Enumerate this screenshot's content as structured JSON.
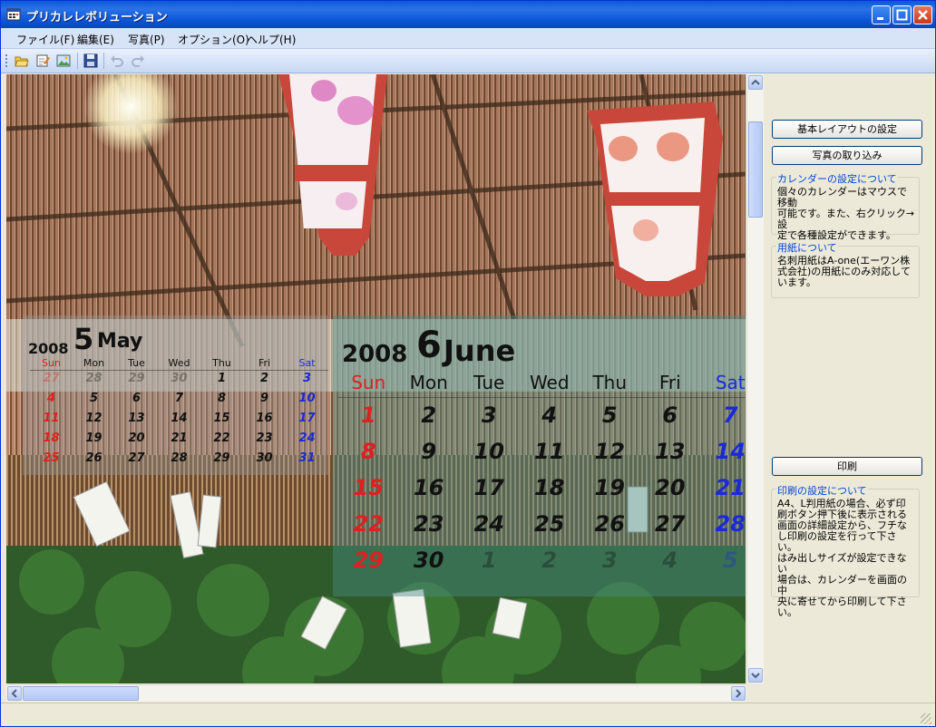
{
  "window": {
    "title": "プリカレレボリューション",
    "controls": [
      "minimize",
      "maximize",
      "close"
    ]
  },
  "menu": [
    "ファイル(F)",
    "編集(E)",
    "写真(P)",
    "オプション(O)",
    "ヘルプ(H)"
  ],
  "toolbar": [
    "open-icon",
    "edit-icon",
    "image-icon",
    "save-icon",
    "undo-icon",
    "redo-icon"
  ],
  "calendar_may": {
    "year": "2008",
    "month_num": "5",
    "month_name": "May",
    "weekdays": [
      "Sun",
      "Mon",
      "Tue",
      "Wed",
      "Thu",
      "Fri",
      "Sat"
    ],
    "weeks": [
      [
        "27",
        "28",
        "29",
        "30",
        "1",
        "2",
        "3"
      ],
      [
        "4",
        "5",
        "6",
        "7",
        "8",
        "9",
        "10"
      ],
      [
        "11",
        "12",
        "13",
        "14",
        "15",
        "16",
        "17"
      ],
      [
        "18",
        "19",
        "20",
        "21",
        "22",
        "23",
        "24"
      ],
      [
        "25",
        "26",
        "27",
        "28",
        "29",
        "30",
        "31"
      ]
    ]
  },
  "calendar_june": {
    "year": "2008",
    "month_num": "6",
    "month_name": "June",
    "weekdays": [
      "Sun",
      "Mon",
      "Tue",
      "Wed",
      "Thu",
      "Fri",
      "Sat"
    ],
    "weeks": [
      [
        "1",
        "2",
        "3",
        "4",
        "5",
        "6",
        "7"
      ],
      [
        "8",
        "9",
        "10",
        "11",
        "12",
        "13",
        "14"
      ],
      [
        "15",
        "16",
        "17",
        "18",
        "19",
        "20",
        "21"
      ],
      [
        "22",
        "23",
        "24",
        "25",
        "26",
        "27",
        "28"
      ],
      [
        "29",
        "30",
        "1",
        "2",
        "3",
        "4",
        "5"
      ]
    ]
  },
  "panel": {
    "layout_button": "基本レイアウトの設定",
    "photo_button": "写真の取り込み",
    "calendar_group": {
      "title": "カレンダーの設定について",
      "lines": [
        "個々のカレンダーはマウスで移動",
        "可能です。また、右クリック→設",
        "定で各種設定ができます。"
      ]
    },
    "paper_group": {
      "title": "用紙について",
      "lines": [
        "名刺用紙はA-one(エーワン株",
        "式会社)の用紙にのみ対応して",
        "います。"
      ]
    },
    "print_button": "印刷",
    "print_group": {
      "title": "印刷の設定について",
      "lines": [
        "A4、L判用紙の場合、必ず印",
        "刷ボタン押下後に表示される",
        "画面の詳細設定から、フチな",
        "し印刷の設定を行って下さい。",
        "はみ出しサイズが設定できない",
        "場合は、カレンダーを画面の中",
        "央に寄せてから印刷して下さい。"
      ]
    }
  },
  "colors": {
    "sun": "#e02020",
    "sat": "#1a2ad8",
    "weekday": "#111111",
    "accent": "#0046d5"
  }
}
